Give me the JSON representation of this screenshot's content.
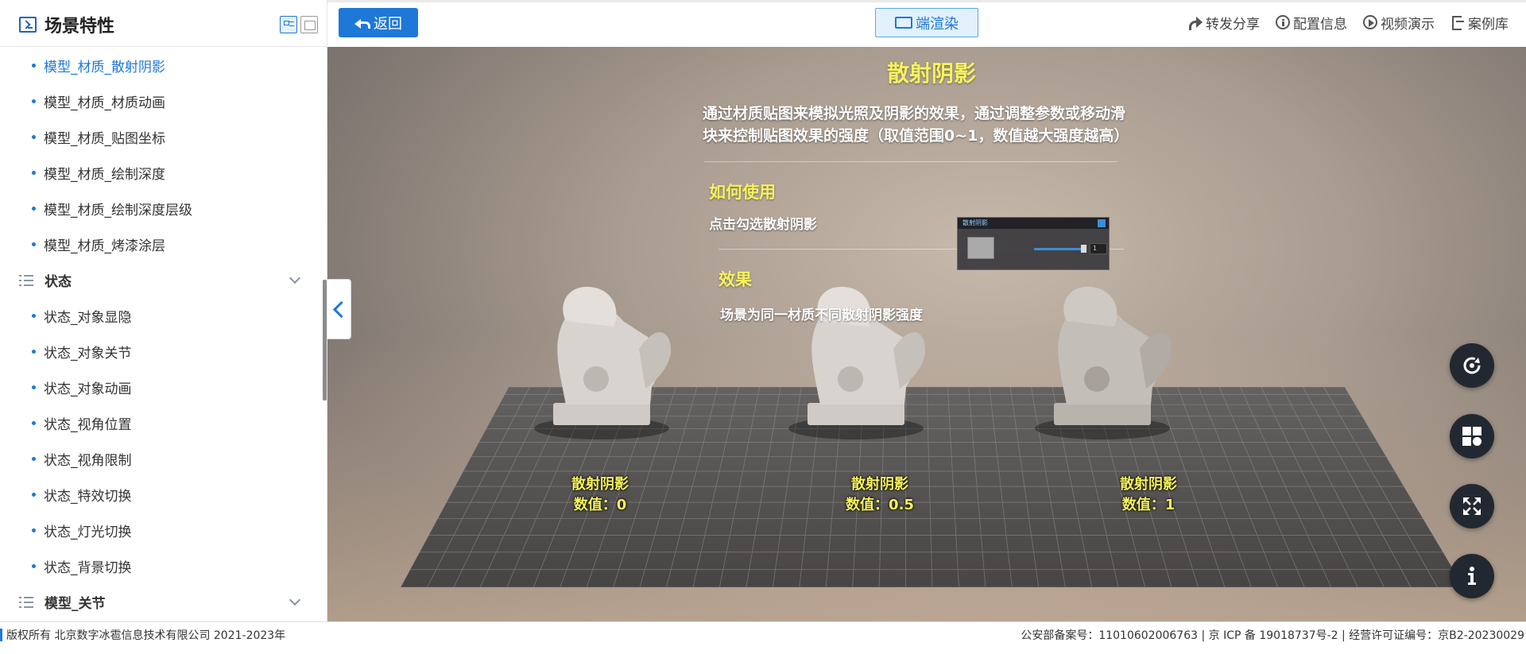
{
  "sidebar": {
    "title": "场景特性",
    "items": [
      {
        "type": "item",
        "label": "模型_材质_散射阴影",
        "active": true
      },
      {
        "type": "item",
        "label": "模型_材质_材质动画"
      },
      {
        "type": "item",
        "label": "模型_材质_贴图坐标"
      },
      {
        "type": "item",
        "label": "模型_材质_绘制深度"
      },
      {
        "type": "item",
        "label": "模型_材质_绘制深度层级"
      },
      {
        "type": "item",
        "label": "模型_材质_烤漆涂层"
      },
      {
        "type": "group",
        "label": "状态"
      },
      {
        "type": "item",
        "label": "状态_对象显隐"
      },
      {
        "type": "item",
        "label": "状态_对象关节"
      },
      {
        "type": "item",
        "label": "状态_对象动画"
      },
      {
        "type": "item",
        "label": "状态_视角位置"
      },
      {
        "type": "item",
        "label": "状态_视角限制"
      },
      {
        "type": "item",
        "label": "状态_特效切换"
      },
      {
        "type": "item",
        "label": "状态_灯光切换"
      },
      {
        "type": "item",
        "label": "状态_背景切换"
      },
      {
        "type": "group",
        "label": "模型_关节"
      }
    ]
  },
  "topbar": {
    "back_label": "返回",
    "render_label": "端渲染",
    "actions": [
      {
        "label": "转发分享",
        "icon": "share-icon"
      },
      {
        "label": "配置信息",
        "icon": "info-circle-icon"
      },
      {
        "label": "视频演示",
        "icon": "play-circle-icon"
      },
      {
        "label": "案例库",
        "icon": "exit-icon"
      }
    ]
  },
  "scene": {
    "title": "散射阴影",
    "description": "通过材质贴图来模拟光照及阴影的效果，通过调整参数或移动滑块来控制贴图效果的强度（取值范围0~1，数值越大强度越高）",
    "how_to_title": "如何使用",
    "how_to_text": "点击勾选散射阴影",
    "effect_title": "效果",
    "effect_text": "场景为同一材质不同散射阴影强度",
    "mini_panel": {
      "header": "散射阴影",
      "value": "1"
    },
    "labels": [
      {
        "name": "散射阴影",
        "value": "数值：0"
      },
      {
        "name": "散射阴影",
        "value": "数值：0.5"
      },
      {
        "name": "散射阴影",
        "value": "数值：1"
      }
    ]
  },
  "fabs": [
    "rotate-icon",
    "layout-icon",
    "fullscreen-icon",
    "info-icon"
  ],
  "footer": {
    "left": "版权所有 北京数字冰雹信息技术有限公司 2021-2023年",
    "right": "公安部备案号：11010602006763 | 京 ICP 备 19018737号-2 | 经营许可证编号：京B2-20230029"
  },
  "colors": {
    "accent": "#1e78d7",
    "highlight_yellow": "#f7f25c",
    "fab_bg": "#222831"
  }
}
